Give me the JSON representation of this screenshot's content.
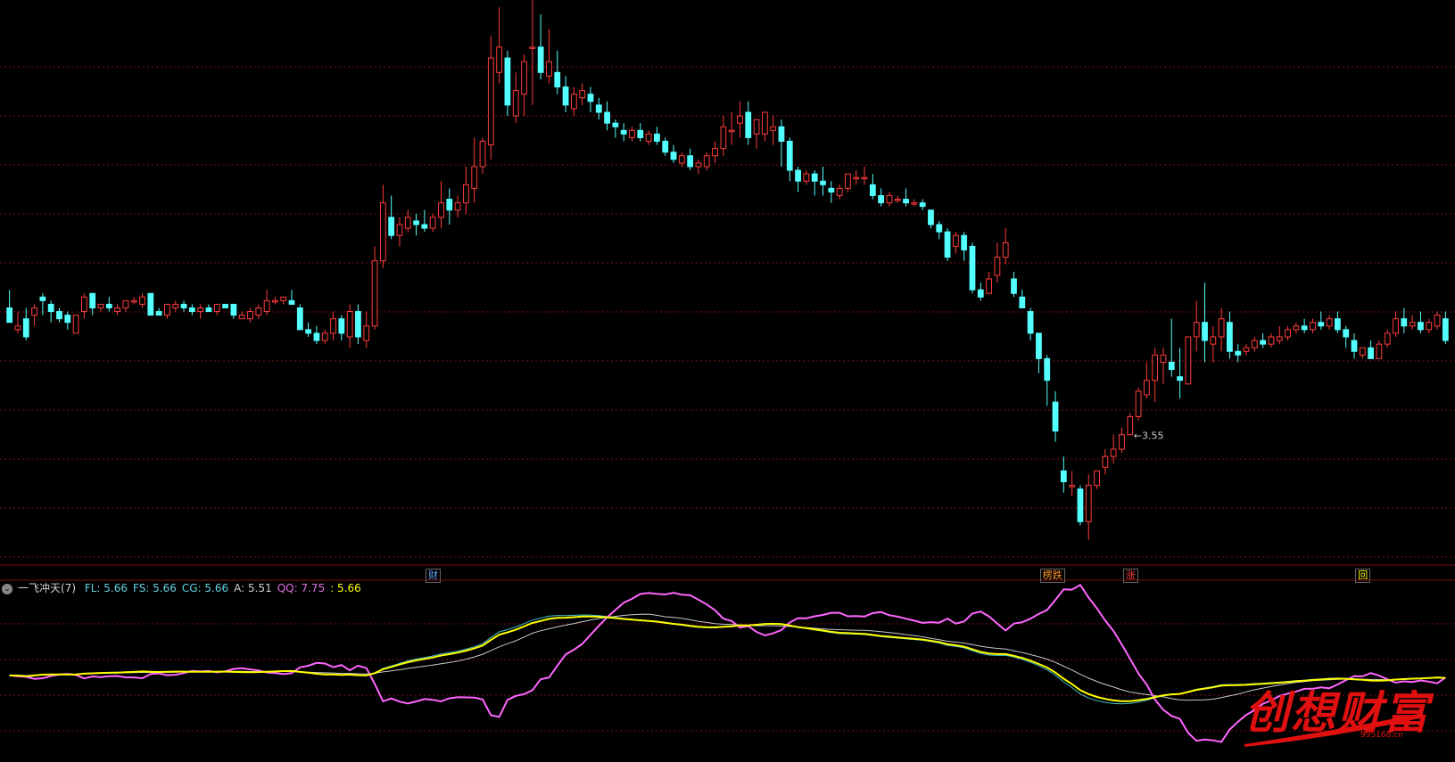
{
  "chart_data": {
    "type": "candlestick",
    "price_range": [
      3.25,
      11.0
    ],
    "candles": [
      [
        6.75,
        7.0,
        6.55,
        6.55
      ],
      [
        6.45,
        6.7,
        6.5,
        6.4
      ],
      [
        6.6,
        6.75,
        6.35,
        6.3
      ],
      [
        6.65,
        6.8,
        6.75,
        6.5
      ],
      [
        6.9,
        6.95,
        6.85,
        6.65
      ],
      [
        6.8,
        6.85,
        6.7,
        6.55
      ],
      [
        6.7,
        6.75,
        6.6,
        6.55
      ],
      [
        6.65,
        6.7,
        6.55,
        6.45
      ],
      [
        6.4,
        6.6,
        6.65,
        6.4
      ],
      [
        6.7,
        6.95,
        6.9,
        6.6
      ],
      [
        6.95,
        6.95,
        6.75,
        6.65
      ],
      [
        6.75,
        6.8,
        6.8,
        6.7
      ],
      [
        6.8,
        6.9,
        6.75,
        6.7
      ],
      [
        6.7,
        6.8,
        6.75,
        6.65
      ],
      [
        6.75,
        6.85,
        6.85,
        6.7
      ],
      [
        6.85,
        6.9,
        6.85,
        6.8
      ],
      [
        6.8,
        6.95,
        6.9,
        6.75
      ],
      [
        6.95,
        6.95,
        6.65,
        6.65
      ],
      [
        6.7,
        6.75,
        6.65,
        6.65
      ],
      [
        6.65,
        6.8,
        6.8,
        6.6
      ],
      [
        6.75,
        6.85,
        6.8,
        6.7
      ],
      [
        6.8,
        6.85,
        6.75,
        6.7
      ],
      [
        6.75,
        6.8,
        6.7,
        6.65
      ],
      [
        6.7,
        6.8,
        6.75,
        6.6
      ],
      [
        6.75,
        6.8,
        6.7,
        6.7
      ],
      [
        6.7,
        6.8,
        6.8,
        6.65
      ],
      [
        6.8,
        6.8,
        6.75,
        6.75
      ],
      [
        6.8,
        6.8,
        6.65,
        6.6
      ],
      [
        6.6,
        6.7,
        6.65,
        6.6
      ],
      [
        6.6,
        6.75,
        6.7,
        6.55
      ],
      [
        6.65,
        6.8,
        6.75,
        6.6
      ],
      [
        6.7,
        7.0,
        6.85,
        6.65
      ],
      [
        6.85,
        6.9,
        6.85,
        6.8
      ],
      [
        6.85,
        6.9,
        6.9,
        6.8
      ],
      [
        6.85,
        7.0,
        6.8,
        6.8
      ],
      [
        6.75,
        6.8,
        6.45,
        6.45
      ],
      [
        6.45,
        6.55,
        6.4,
        6.35
      ],
      [
        6.4,
        6.5,
        6.3,
        6.25
      ],
      [
        6.3,
        6.45,
        6.4,
        6.25
      ],
      [
        6.4,
        6.7,
        6.6,
        6.3
      ],
      [
        6.6,
        6.65,
        6.4,
        6.3
      ],
      [
        6.35,
        6.8,
        6.7,
        6.2
      ],
      [
        6.7,
        6.8,
        6.35,
        6.25
      ],
      [
        6.3,
        6.7,
        6.5,
        6.2
      ],
      [
        6.5,
        7.6,
        7.4,
        6.45
      ],
      [
        7.4,
        8.45,
        8.2,
        7.3
      ],
      [
        8.0,
        8.3,
        7.75,
        7.7
      ],
      [
        7.75,
        8.0,
        7.9,
        7.6
      ],
      [
        7.85,
        8.1,
        8.0,
        7.8
      ],
      [
        7.95,
        8.05,
        7.9,
        7.75
      ],
      [
        7.9,
        8.1,
        7.85,
        7.8
      ],
      [
        7.85,
        8.05,
        8.0,
        7.8
      ],
      [
        8.0,
        8.5,
        8.2,
        7.85
      ],
      [
        8.25,
        8.4,
        8.1,
        7.9
      ],
      [
        8.1,
        8.3,
        8.2,
        8.0
      ],
      [
        8.2,
        8.7,
        8.45,
        8.05
      ],
      [
        8.4,
        9.1,
        8.7,
        8.2
      ],
      [
        8.7,
        9.1,
        9.05,
        8.6
      ],
      [
        9.0,
        10.5,
        10.2,
        8.8
      ],
      [
        10.0,
        10.9,
        10.35,
        9.85
      ],
      [
        10.2,
        10.3,
        9.55,
        9.4
      ],
      [
        9.4,
        10.0,
        9.75,
        9.3
      ],
      [
        9.7,
        10.25,
        10.15,
        9.4
      ],
      [
        10.35,
        11.0,
        10.35,
        9.55
      ],
      [
        10.35,
        10.8,
        10.0,
        9.9
      ],
      [
        9.95,
        10.6,
        10.15,
        9.85
      ],
      [
        10.0,
        10.3,
        9.8,
        9.7
      ],
      [
        9.8,
        9.95,
        9.55,
        9.45
      ],
      [
        9.5,
        9.8,
        9.7,
        9.4
      ],
      [
        9.65,
        9.85,
        9.75,
        9.55
      ],
      [
        9.7,
        9.8,
        9.6,
        9.45
      ],
      [
        9.55,
        9.65,
        9.45,
        9.35
      ],
      [
        9.45,
        9.6,
        9.3,
        9.2
      ],
      [
        9.3,
        9.35,
        9.25,
        9.1
      ],
      [
        9.2,
        9.3,
        9.15,
        9.05
      ],
      [
        9.1,
        9.25,
        9.2,
        9.05
      ],
      [
        9.2,
        9.3,
        9.1,
        9.05
      ],
      [
        9.05,
        9.2,
        9.15,
        9.0
      ],
      [
        9.15,
        9.25,
        9.05,
        9.0
      ],
      [
        9.05,
        9.1,
        8.9,
        8.85
      ],
      [
        8.9,
        9.0,
        8.8,
        8.75
      ],
      [
        8.75,
        8.9,
        8.85,
        8.7
      ],
      [
        8.85,
        8.95,
        8.7,
        8.65
      ],
      [
        8.7,
        8.8,
        8.75,
        8.6
      ],
      [
        8.7,
        8.9,
        8.85,
        8.65
      ],
      [
        8.85,
        9.05,
        8.95,
        8.75
      ],
      [
        8.95,
        9.4,
        9.25,
        8.85
      ],
      [
        9.2,
        9.45,
        9.2,
        9.0
      ],
      [
        9.3,
        9.6,
        9.4,
        9.1
      ],
      [
        9.45,
        9.6,
        9.1,
        9.0
      ],
      [
        9.15,
        9.2,
        9.35,
        8.95
      ],
      [
        9.15,
        9.2,
        9.45,
        9.05
      ],
      [
        9.2,
        9.4,
        9.25,
        9.0
      ],
      [
        9.25,
        9.35,
        9.05,
        8.7
      ],
      [
        9.05,
        9.1,
        8.65,
        8.5
      ],
      [
        8.65,
        8.7,
        8.5,
        8.35
      ],
      [
        8.5,
        8.65,
        8.6,
        8.45
      ],
      [
        8.6,
        8.65,
        8.5,
        8.3
      ],
      [
        8.5,
        8.7,
        8.45,
        8.3
      ],
      [
        8.4,
        8.5,
        8.35,
        8.2
      ],
      [
        8.3,
        8.45,
        8.4,
        8.25
      ],
      [
        8.4,
        8.6,
        8.6,
        8.35
      ],
      [
        8.55,
        8.65,
        8.55,
        8.45
      ],
      [
        8.55,
        8.7,
        8.55,
        8.45
      ],
      [
        8.45,
        8.6,
        8.3,
        8.25
      ],
      [
        8.3,
        8.4,
        8.2,
        8.15
      ],
      [
        8.2,
        8.35,
        8.3,
        8.15
      ],
      [
        8.25,
        8.3,
        8.25,
        8.2
      ],
      [
        8.25,
        8.4,
        8.2,
        8.15
      ],
      [
        8.2,
        8.25,
        8.2,
        8.15
      ],
      [
        8.2,
        8.25,
        8.15,
        8.1
      ],
      [
        8.1,
        8.1,
        7.9,
        7.85
      ],
      [
        7.9,
        7.95,
        7.8,
        7.7
      ],
      [
        7.8,
        7.85,
        7.45,
        7.4
      ],
      [
        7.6,
        7.8,
        7.75,
        7.5
      ],
      [
        7.75,
        7.8,
        7.55,
        7.4
      ],
      [
        7.6,
        7.65,
        7.0,
        6.95
      ],
      [
        7.0,
        7.1,
        6.9,
        6.85
      ],
      [
        6.95,
        7.25,
        7.15,
        6.95
      ],
      [
        7.2,
        7.65,
        7.45,
        7.1
      ],
      [
        7.45,
        7.85,
        7.65,
        7.35
      ],
      [
        7.15,
        7.25,
        6.95,
        6.9
      ],
      [
        6.9,
        7.0,
        6.75,
        6.75
      ],
      [
        6.7,
        6.75,
        6.4,
        6.3
      ],
      [
        6.4,
        6.4,
        6.05,
        5.85
      ],
      [
        6.05,
        6.1,
        5.75,
        5.4
      ],
      [
        5.45,
        5.6,
        5.05,
        4.9
      ],
      [
        4.5,
        4.7,
        4.35,
        4.2
      ],
      [
        4.3,
        4.5,
        4.3,
        4.15
      ],
      [
        4.25,
        4.3,
        3.8,
        3.75
      ],
      [
        3.8,
        4.45,
        4.3,
        3.55
      ],
      [
        4.3,
        4.5,
        4.5,
        4.25
      ],
      [
        4.55,
        4.8,
        4.7,
        4.45
      ],
      [
        4.7,
        5.0,
        4.8,
        4.6
      ],
      [
        4.8,
        5.1,
        5.0,
        4.75
      ],
      [
        5.0,
        5.3,
        5.25,
        5.0
      ],
      [
        5.25,
        5.65,
        5.6,
        5.2
      ],
      [
        5.55,
        6.0,
        5.75,
        5.5
      ],
      [
        5.75,
        6.2,
        6.1,
        5.45
      ],
      [
        6.0,
        6.2,
        6.1,
        5.7
      ],
      [
        6.0,
        6.6,
        5.9,
        5.8
      ],
      [
        5.8,
        6.2,
        5.75,
        5.5
      ],
      [
        5.7,
        6.3,
        6.35,
        5.7
      ],
      [
        6.35,
        6.85,
        6.55,
        6.15
      ],
      [
        6.55,
        7.1,
        6.3,
        6.0
      ],
      [
        6.25,
        6.5,
        6.35,
        6.0
      ],
      [
        6.35,
        6.75,
        6.6,
        6.15
      ],
      [
        6.55,
        6.7,
        6.15,
        6.05
      ],
      [
        6.15,
        6.25,
        6.1,
        6.0
      ],
      [
        6.15,
        6.25,
        6.2,
        6.1
      ],
      [
        6.2,
        6.35,
        6.3,
        6.15
      ],
      [
        6.3,
        6.4,
        6.25,
        6.2
      ],
      [
        6.25,
        6.4,
        6.35,
        6.2
      ],
      [
        6.3,
        6.5,
        6.35,
        6.25
      ],
      [
        6.35,
        6.5,
        6.45,
        6.3
      ],
      [
        6.45,
        6.55,
        6.5,
        6.4
      ],
      [
        6.5,
        6.6,
        6.45,
        6.4
      ],
      [
        6.45,
        6.6,
        6.55,
        6.4
      ],
      [
        6.55,
        6.7,
        6.5,
        6.45
      ],
      [
        6.5,
        6.65,
        6.6,
        6.45
      ],
      [
        6.6,
        6.7,
        6.45,
        6.4
      ],
      [
        6.45,
        6.5,
        6.35,
        6.2
      ],
      [
        6.3,
        6.4,
        6.15,
        6.05
      ],
      [
        6.1,
        6.2,
        6.2,
        6.05
      ],
      [
        6.2,
        6.3,
        6.05,
        6.05
      ],
      [
        6.05,
        6.3,
        6.25,
        6.05
      ],
      [
        6.25,
        6.45,
        6.4,
        6.2
      ],
      [
        6.4,
        6.7,
        6.6,
        6.35
      ],
      [
        6.6,
        6.75,
        6.5,
        6.4
      ],
      [
        6.5,
        6.65,
        6.55,
        6.45
      ],
      [
        6.55,
        6.7,
        6.45,
        6.4
      ],
      [
        6.45,
        6.6,
        6.55,
        6.4
      ],
      [
        6.5,
        6.7,
        6.65,
        6.45
      ],
      [
        6.6,
        6.7,
        6.3,
        6.25
      ]
    ],
    "low_annotation": {
      "index": 135,
      "label": "←3.55"
    },
    "markers": [
      {
        "index": 51,
        "text": "财",
        "color": "#5aa8ff"
      },
      {
        "index": 125,
        "text": "楞跌",
        "color": "#ff9a2a"
      },
      {
        "index": 135,
        "text": "涨",
        "color": "#ff4040"
      },
      {
        "index": 163,
        "text": "回",
        "color": "#ffff00"
      }
    ],
    "indicator": {
      "name": "一飞冲天(7)",
      "fields": [
        {
          "label": "FL:",
          "value": "5.66",
          "color": "#5fd3e0"
        },
        {
          "label": "FS:",
          "value": "5.66",
          "color": "#5fd3e0"
        },
        {
          "label": "CG:",
          "value": "5.66",
          "color": "#5fd3e0"
        },
        {
          "label": "A:",
          "value": "5.51",
          "color": "#d0d0d0"
        },
        {
          "label": "QQ:",
          "value": "7.75",
          "color": "#e070e0"
        },
        {
          "label": ":",
          "value": "5.66",
          "color": "#ffff00"
        }
      ]
    },
    "colors": {
      "up": "#ff3c3c",
      "down": "#54ffff",
      "grid": "#801010",
      "yellow": "#ffff00",
      "pink": "#ff66ff",
      "grey": "#c8c8c8",
      "cyan": "#3fc0c8"
    }
  },
  "watermark": {
    "text": "创想财富",
    "url": "995168.cn"
  }
}
